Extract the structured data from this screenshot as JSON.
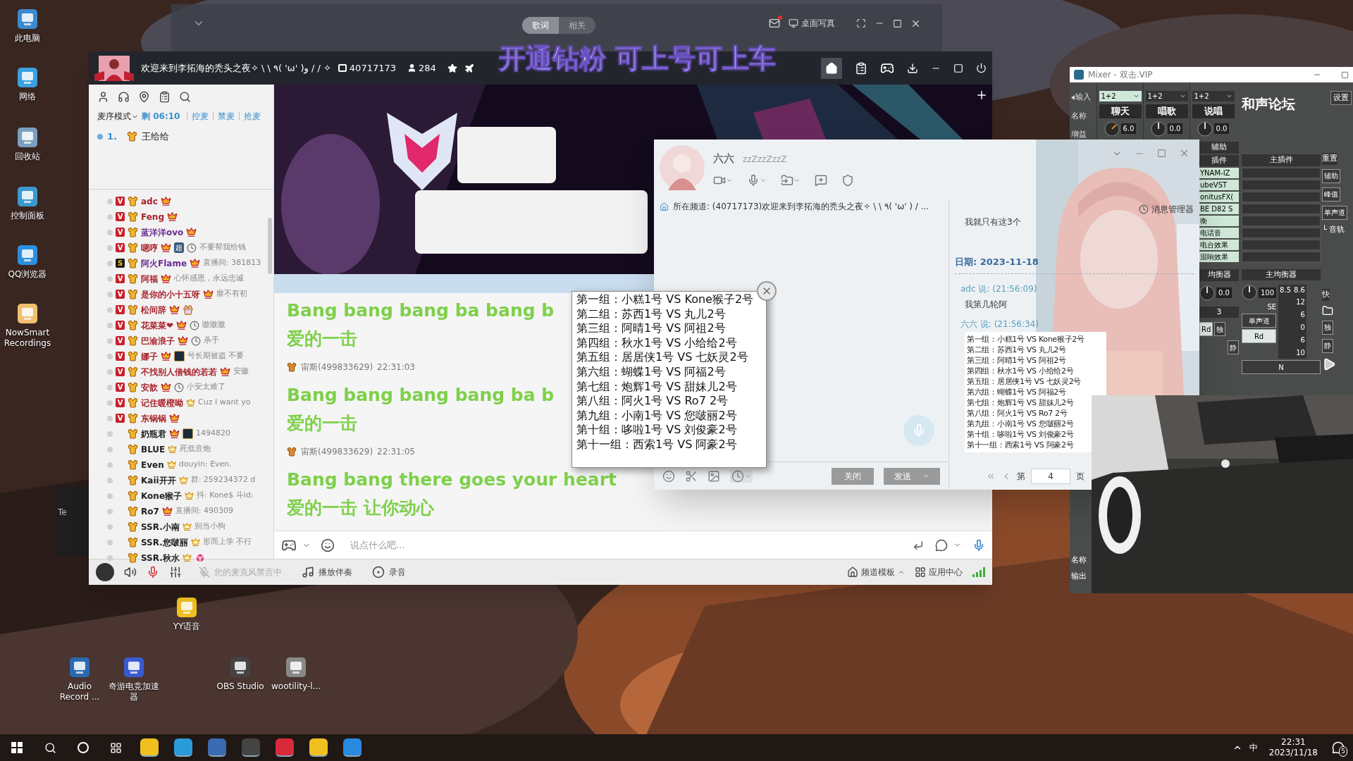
{
  "desktop_icons": [
    {
      "label": "此电脑"
    },
    {
      "label": "网络"
    },
    {
      "label": "回收站"
    },
    {
      "label": "控制面板"
    },
    {
      "label": "QQ浏览器"
    },
    {
      "label": "NowSmart Recordings"
    }
  ],
  "desktop_icons_bottom": [
    {
      "label": "YY语音"
    },
    {
      "label": "Audio Record ..."
    },
    {
      "label": "奇游电竞加速器"
    },
    {
      "label": "OBS Studio"
    },
    {
      "label": "wootility-l..."
    }
  ],
  "hidden_window_text": "Te",
  "lyrics_window": {
    "tabs": [
      {
        "label": "歌词",
        "selected": true
      },
      {
        "label": "相关",
        "selected": false
      }
    ],
    "action": "桌面写真",
    "lyric": "开通钻粉 可上号可上车"
  },
  "yy": {
    "title": "欢迎来到李拓海的秃头之夜✧ \\ \\ ٩( 'ω' )و / / ✧",
    "channel_id": "40717173",
    "online": "284",
    "mic_queue": {
      "mode": "麦序模式",
      "remaining": "剩 06:10",
      "actions": [
        "控麦",
        "禁麦",
        "抢麦"
      ],
      "entries": [
        {
          "index": "1.",
          "name": "王给给"
        }
      ]
    },
    "members": [
      {
        "badge": "V",
        "name": "adc",
        "color": "#a8232d",
        "icons": [
          {
            "kind": "crown"
          }
        ]
      },
      {
        "badge": "V",
        "name": "Feng",
        "color": "#a8232d",
        "icons": [
          {
            "kind": "crown"
          }
        ]
      },
      {
        "badge": "V",
        "name": "蓝洋洋ovo",
        "color": "#6a2c91",
        "icons": [
          {
            "kind": "crown"
          }
        ]
      },
      {
        "badge": "V",
        "name": "嗯哼",
        "color": "#a8232d",
        "icons": [
          {
            "kind": "crown"
          },
          {
            "kind": "tag",
            "label": "超"
          },
          {
            "kind": "clock"
          }
        ],
        "message": "不要帮我给钱"
      },
      {
        "badge": "S",
        "name": "阿火Flame",
        "color": "#6a2c91",
        "icons": [
          {
            "kind": "crown"
          }
        ],
        "message": "直播间: 381813"
      },
      {
        "badge": "V",
        "name": "阿福",
        "color": "#a8232d",
        "icons": [
          {
            "kind": "crown"
          }
        ],
        "message": "心怀感恩，永远忠诚"
      },
      {
        "badge": "V",
        "name": "是你的小十五呀",
        "color": "#a8232d",
        "icons": [
          {
            "kind": "crown"
          }
        ],
        "message": "靡不有初"
      },
      {
        "badge": "V",
        "name": "松间辞",
        "color": "#a8232d",
        "icons": [
          {
            "kind": "crown"
          },
          {
            "kind": "gift"
          }
        ]
      },
      {
        "badge": "V",
        "name": "花菜菜❤",
        "color": "#a8232d",
        "icons": [
          {
            "kind": "crown"
          },
          {
            "kind": "clock"
          }
        ],
        "message": "嗷嗷嗷"
      },
      {
        "badge": "V",
        "name": "巴渝浪子",
        "color": "#a8232d",
        "icons": [
          {
            "kind": "crown"
          },
          {
            "kind": "clock"
          }
        ],
        "message": "杀手"
      },
      {
        "badge": "V",
        "name": "娜子",
        "color": "#a8232d",
        "icons": [
          {
            "kind": "crown"
          },
          {
            "kind": "league"
          }
        ],
        "message": "号长期被盗 不要"
      },
      {
        "badge": "V",
        "name": "不找别人借钱的若若",
        "color": "#a8232d",
        "icons": [
          {
            "kind": "crown"
          }
        ],
        "message": "安徽"
      },
      {
        "badge": "V",
        "name": "安歆",
        "color": "#a8232d",
        "icons": [
          {
            "kind": "crown"
          },
          {
            "kind": "clock"
          }
        ],
        "message": "小安太难了"
      },
      {
        "badge": "V",
        "name": "记住暖橙呦",
        "color": "#a8232d",
        "icons": [
          {
            "kind": "small_crown"
          }
        ],
        "message": "Cuz I want yo"
      },
      {
        "badge": "V",
        "name": "东锅锅",
        "color": "#a8232d",
        "icons": [
          {
            "kind": "crown"
          }
        ]
      },
      {
        "name": "奶瓶君",
        "color": "#222222",
        "icons": [
          {
            "kind": "crown"
          },
          {
            "kind": "league"
          }
        ],
        "message": "1494820"
      },
      {
        "name": "BLUE",
        "color": "#222222",
        "icons": [
          {
            "kind": "small_crown"
          }
        ],
        "message": "死低音炮"
      },
      {
        "name": "Even",
        "color": "#222222",
        "icons": [
          {
            "kind": "small_crown"
          }
        ],
        "message": "douyin: Even."
      },
      {
        "name": "Kaii开开",
        "color": "#222222",
        "icons": [
          {
            "kind": "small_crown"
          }
        ],
        "message": "群: 259234372 d"
      },
      {
        "name": "Kone猴子",
        "color": "#222222",
        "icons": [
          {
            "kind": "small_crown"
          }
        ],
        "message": "抖: Kone$ 斗id:"
      },
      {
        "name": "Ro7",
        "color": "#222222",
        "icons": [
          {
            "kind": "crown"
          }
        ],
        "message": "直播间: 490309"
      },
      {
        "name": "SSR.小南",
        "color": "#222222",
        "icons": [
          {
            "kind": "small_crown"
          }
        ],
        "message": "别当小狗"
      },
      {
        "name": "SSR.您啵丽",
        "color": "#222222",
        "icons": [
          {
            "kind": "small_crown"
          }
        ],
        "message": "形而上学 不行"
      },
      {
        "name": "SSR.秋水",
        "color": "#222222",
        "icons": [
          {
            "kind": "small_crown"
          },
          {
            "kind": "cube"
          }
        ]
      }
    ],
    "messages": [
      {
        "lines": [
          "Bang bang bang ba bang b",
          "爱的一击"
        ]
      },
      {
        "sender": "宙斯(499833629)",
        "time": "22:31:03",
        "lines": [
          "Bang bang bang bang ba b",
          "爱的一击"
        ]
      },
      {
        "sender": "宙斯(499833629)",
        "time": "22:31:05",
        "lines": [
          "Bang bang there goes your heart",
          "爱的一击 让你动心"
        ]
      }
    ],
    "input": {
      "placeholder": "说点什么吧..."
    },
    "bottom_bar": {
      "mic_status": "您的麦克风禁言中",
      "accompaniment": "播放伴奏",
      "record": "录音",
      "template": "频道模板",
      "apps": "应用中心"
    }
  },
  "chat_window": {
    "name": "六六",
    "signature": "zzZzzZzzZ",
    "channel": "所在频道: (40717173)欢迎来到李拓海的秃头之夜✧ \\ \\ ٩( 'ω' ) / ...",
    "close": "关闭",
    "send": "发送",
    "history": {
      "manager": "消息管理器",
      "earlier": "我就只有这3个",
      "date": "日期: 2023-11-18",
      "entries": [
        {
          "header": "adc 说: (21:56:09)",
          "body": "我第几轮阿"
        },
        {
          "header": "六六 说: (21:56:34)"
        }
      ],
      "groups": [
        "第一组：小糕1号 VS Kone猴子2号",
        "第二组：苏西1号 VS 丸儿2号",
        "第三组：阿晴1号 VS 阿祖2号",
        "第四组：秋水1号 VS 小给给2号",
        "第五组：居居侠1号 VS 七妖灵2号",
        "第六组：蝴蝶1号 VS 阿福2号",
        "第七组：炮辉1号 VS 甜妹儿2号",
        "第八组：阿火1号 VS Ro7 2号",
        "第九组：小南1号 VS 您啵丽2号",
        "第十组：哆啦1号 VS 刘俊豪2号",
        "第十一组：西索1号 VS 阿豪2号"
      ],
      "pager": {
        "prefix": "第",
        "page": "4",
        "suffix": "页"
      }
    }
  },
  "popup": {
    "groups": [
      "第一组：小糕1号 VS Kone猴子2号",
      "第二组：苏西1号 VS 丸儿2号",
      "第三组：阿晴1号 VS 阿祖2号",
      "第四组：秋水1号 VS 小给给2号",
      "第五组：居居侠1号 VS 七妖灵2号",
      "第六组：蝴蝶1号 VS 阿福2号",
      "第七组：炮辉1号 VS 甜妹儿2号",
      "第八组：阿火1号 VS Ro7 2号",
      "第九组：小南1号 VS 您啵丽2号",
      "第十组：哆啦1号 VS 刘俊豪2号",
      "第十一组：西索1号 VS 阿豪2号"
    ]
  },
  "mixer": {
    "title": "Mixer - 双击.VIP",
    "input_label": "输入",
    "row_labels": [
      "名称",
      "增益"
    ],
    "channels": [
      {
        "routing": "1+2",
        "name": "聊天",
        "gain": "6.0"
      },
      {
        "routing": "1+2",
        "name": "唱歌",
        "gain": "0.0"
      },
      {
        "routing": "1+2",
        "name": "说唱",
        "gain": "0.0"
      }
    ],
    "brand": "和声论坛",
    "settings": "设置",
    "aux": "辅助",
    "plugins_label": "插件",
    "master_plugins_label": "主插件",
    "reset": "重置",
    "plugins": [
      "YNAM-IZ",
      "ubeVST",
      "onitusFX(",
      "BE D82 S",
      "衡",
      "电话音",
      "电台效果",
      "混响效果"
    ],
    "side_buttons": [
      "辅助",
      "峰值",
      "单声道"
    ],
    "track": "└ 音轨",
    "eq_label": "均衡器",
    "master_eq_label": "主均衡器",
    "quick_label": "快",
    "eq_value": "0.0",
    "master_value": "100",
    "master_unit": "SE",
    "meter_readings": [
      "8.5",
      "8.6"
    ],
    "meter_scale": [
      "12",
      "6",
      "0",
      "6",
      "10"
    ],
    "channel_number": "3",
    "mono": "单声道",
    "n": "N",
    "rd": [
      "Rd",
      "Rd"
    ],
    "solo": [
      "独",
      "独"
    ],
    "mute": [
      "静",
      "静"
    ],
    "bottom_labels": [
      "名称",
      "输出"
    ]
  },
  "taskbar": {
    "ime": "中",
    "time": "22:31",
    "date": "2023/11/18",
    "notifications": "5"
  }
}
